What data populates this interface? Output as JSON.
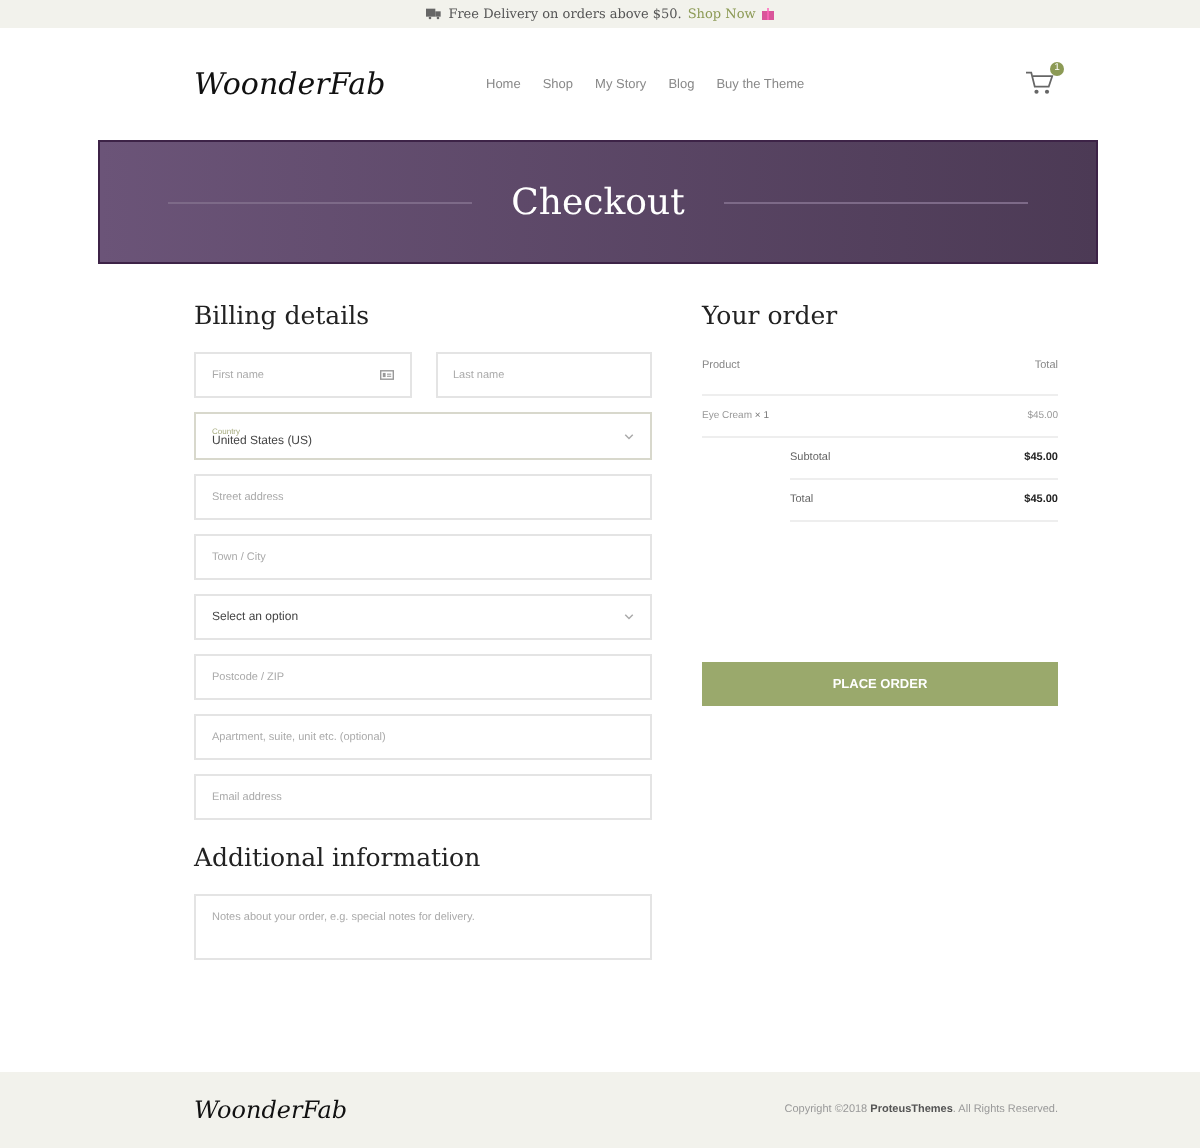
{
  "topbar": {
    "text": "Free Delivery on orders above $50.",
    "link": "Shop Now"
  },
  "header": {
    "logo": "WoonderFab",
    "nav": [
      {
        "label": "Home"
      },
      {
        "label": "Shop"
      },
      {
        "label": "My Story"
      },
      {
        "label": "Blog"
      },
      {
        "label": "Buy the Theme"
      }
    ],
    "cart_count": "1"
  },
  "banner": {
    "title": "Checkout"
  },
  "billing": {
    "title": "Billing details",
    "fields": [
      {
        "kind": "pair",
        "items": [
          {
            "placeholder": "First name",
            "card_icon": true
          },
          {
            "placeholder": "Last name",
            "card_icon": false
          }
        ]
      },
      {
        "kind": "select",
        "label": "Country",
        "value": "United States (US)",
        "focused": true
      },
      {
        "kind": "input",
        "placeholder": "Street address"
      },
      {
        "kind": "input",
        "placeholder": "Town / City"
      },
      {
        "kind": "select",
        "value": "Select an option",
        "focused": false
      },
      {
        "kind": "input",
        "placeholder": "Postcode / ZIP"
      },
      {
        "kind": "input",
        "placeholder": "Apartment, suite, unit etc. (optional)"
      },
      {
        "kind": "input",
        "placeholder": "Email address"
      }
    ]
  },
  "additional": {
    "title": "Additional information",
    "notes_placeholder": "Notes about your order, e.g. special notes for delivery."
  },
  "order": {
    "title": "Your order",
    "head": [
      "Product",
      "Total"
    ],
    "items": [
      {
        "name": "Eye Cream",
        "qty": "× 1",
        "price": "$45.00"
      }
    ],
    "totals": [
      {
        "label": "Subtotal",
        "value": "$45.00"
      },
      {
        "label": "Total",
        "value": "$45.00"
      }
    ],
    "button": "PLACE ORDER"
  },
  "footer": {
    "logo": "WoonderFab",
    "copyright": "Copyright ©2018 **ProteusThemes**. All Rights Reserved."
  }
}
